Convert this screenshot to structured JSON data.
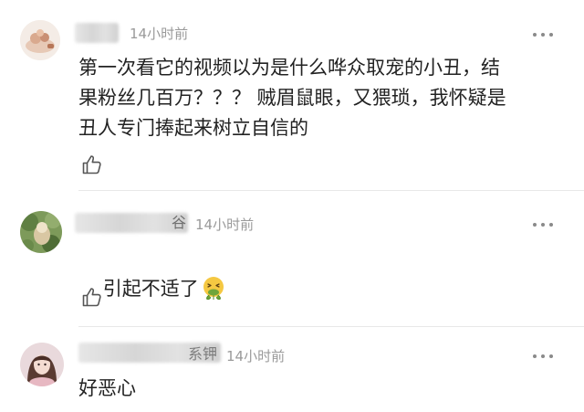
{
  "comments": [
    {
      "time": "14小时前",
      "text": "第一次看它的视频以为是什么哗众取宠的小丑，结\n果粉丝几百万？？？ 贼眉鼠眼，又猥琐，我怀疑是\n丑人专门捧起来树立自信的",
      "name_fragment": ""
    },
    {
      "time": "14小时前",
      "text": "引起不适了",
      "emoji": "nauseated-face-emoji",
      "name_fragment": "谷"
    },
    {
      "time": "14小时前",
      "text": "好恶心",
      "name_fragment": "系钾"
    }
  ],
  "icons": {
    "like": "thumbs-up-icon",
    "more": "more-dots-icon"
  },
  "colors": {
    "text": "#222222",
    "meta": "#9a9a9a",
    "divider": "#e8e8e8"
  }
}
